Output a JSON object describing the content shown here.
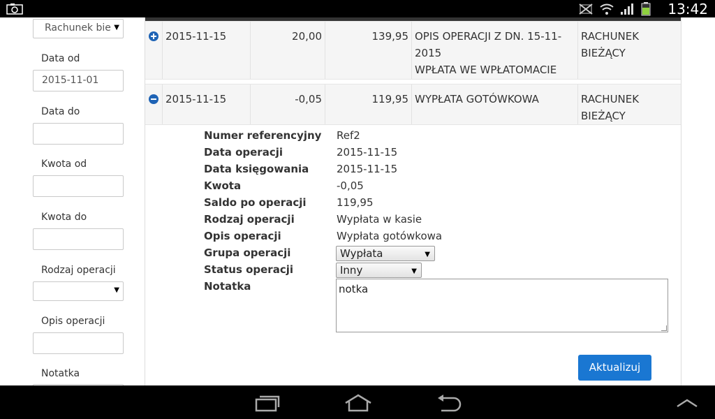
{
  "statusbar": {
    "time": "13:42"
  },
  "filter": {
    "account_select": "Rachunek bie",
    "date_from_label": "Data od",
    "date_from_value": "2015-11-01",
    "date_to_label": "Data do",
    "date_to_value": "",
    "amount_from_label": "Kwota od",
    "amount_to_label": "Kwota do",
    "operation_type_label": "Rodzaj operacji",
    "operation_type_value": "",
    "operation_desc_label": "Opis operacji",
    "note_label": "Notatka"
  },
  "rows": [
    {
      "date": "2015-11-15",
      "amount": "20,00",
      "balance": "139,95",
      "description_1": "OPIS OPERACJI Z DN. 15-11-",
      "description_2": "2015",
      "description_3": "WPŁATA WE WPŁATOMACIE",
      "account_1": "RACHUNEK",
      "account_2": "BIEŻĄCY"
    },
    {
      "date": "2015-11-15",
      "amount": "-0,05",
      "balance": "119,95",
      "description_1": "WYPŁATA GOTÓWKOWA",
      "account_1": "RACHUNEK",
      "account_2": "BIEŻĄCY"
    }
  ],
  "detail": {
    "ref_label": "Numer referencyjny",
    "ref_value": "Ref2",
    "op_date_label": "Data operacji",
    "op_date_value": "2015-11-15",
    "book_date_label": "Data księgowania",
    "book_date_value": "2015-11-15",
    "amount_label": "Kwota",
    "amount_value": "-0,05",
    "balance_label": "Saldo po operacji",
    "balance_value": "119,95",
    "type_label": "Rodzaj operacji",
    "type_value": "Wypłata w kasie",
    "desc_label": "Opis operacji",
    "desc_value": "Wypłata gotówkowa",
    "group_label": "Grupa operacji",
    "group_value": "Wypłata",
    "status_label": "Status operacji",
    "status_value": "Inny",
    "note_label": "Notatka",
    "note_value": "notka",
    "update_button": "Aktualizuj"
  },
  "colors": {
    "accent": "#1a77d2",
    "toggle": "#1e63b5"
  }
}
